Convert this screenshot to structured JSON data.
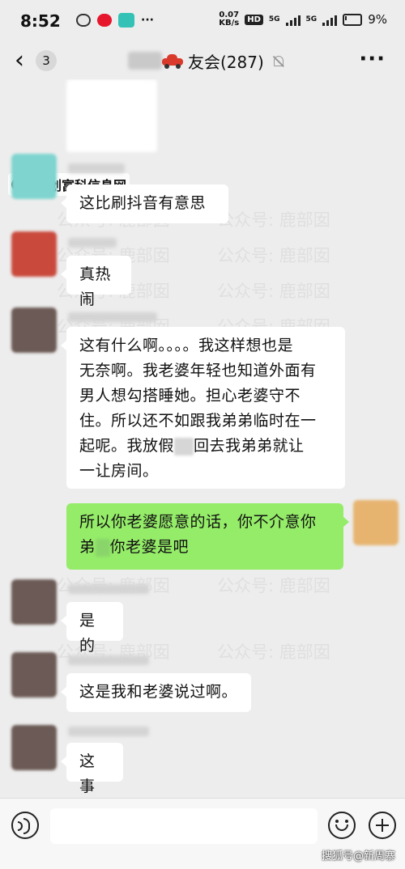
{
  "status_bar": {
    "time": "8:52",
    "net_speed_value": "0.07",
    "net_speed_unit": "KB/s",
    "hd_label": "HD",
    "sig1_label": "5G",
    "sig2_label": "5G",
    "battery": "9%"
  },
  "header": {
    "unread_count": "3",
    "title": "友会(287)",
    "more_label": "···"
  },
  "watermarks": {
    "logo": "乐创富科信息网",
    "text_a": "公众号:",
    "text_b": "鹿部囡"
  },
  "messages": [
    {
      "sender": "other",
      "text": "这比刷抖音有意思"
    },
    {
      "sender": "other",
      "text": "真热闹"
    },
    {
      "sender": "other",
      "text_lines": [
        "这有什么啊。。。。我这样想也是",
        "无奈啊。我老婆年轻也知道外面有",
        "男人想勾搭睡她。担心老婆守不",
        "住。所以还不如跟我弟弟临时在一",
        "起呢。我放假",
        "回去我弟弟就让",
        "一让房间。"
      ]
    },
    {
      "sender": "me",
      "text_lines": [
        "所以你老婆愿意的话，你不介意你",
        "弟",
        "你老婆是吧"
      ]
    },
    {
      "sender": "other",
      "text": "是的"
    },
    {
      "sender": "other",
      "text": "这是我和老婆说过啊。"
    },
    {
      "sender": "other",
      "text": "这事"
    }
  ],
  "bottom": {
    "source_credit": "搜狐号@新周寨"
  },
  "colors": {
    "background": "#ededed",
    "my_bubble": "#95ec69",
    "other_bubble": "#ffffff"
  }
}
